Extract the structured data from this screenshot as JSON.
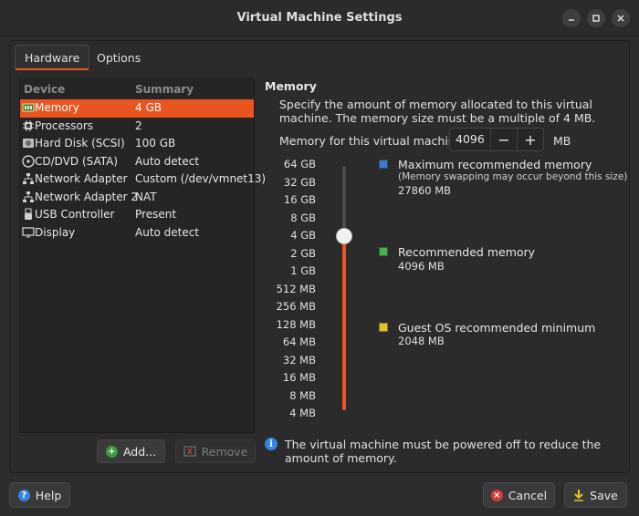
{
  "window": {
    "title": "Virtual Machine Settings"
  },
  "tabs": [
    {
      "label": "Hardware",
      "active": true
    },
    {
      "label": "Options",
      "active": false
    }
  ],
  "device_list": {
    "columns": [
      "Device",
      "Summary"
    ],
    "items": [
      {
        "name": "Memory",
        "summary": "4 GB",
        "icon": "memory-icon",
        "selected": true
      },
      {
        "name": "Processors",
        "summary": "2",
        "icon": "processor-icon"
      },
      {
        "name": "Hard Disk (SCSI)",
        "summary": "100 GB",
        "icon": "hard-disk-icon"
      },
      {
        "name": "CD/DVD (SATA)",
        "summary": "Auto detect",
        "icon": "cd-dvd-icon"
      },
      {
        "name": "Network Adapter",
        "summary": "Custom (/dev/vmnet13)",
        "icon": "network-icon"
      },
      {
        "name": "Network Adapter 2",
        "summary": "NAT",
        "icon": "network-icon"
      },
      {
        "name": "USB Controller",
        "summary": "Present",
        "icon": "usb-icon"
      },
      {
        "name": "Display",
        "summary": "Auto detect",
        "icon": "display-icon"
      }
    ],
    "add_label": "Add...",
    "remove_label": "Remove"
  },
  "memory": {
    "title": "Memory",
    "description": "Specify the amount of memory allocated to this virtual machine. The memory size must be a multiple of 4 MB.",
    "field_label": "Memory for this virtual machine:",
    "value": "4096",
    "unit": "MB",
    "decrement": "−",
    "increment": "+",
    "scale": [
      "64 GB",
      "32 GB",
      "16 GB",
      "8 GB",
      "4 GB",
      "2 GB",
      "1 GB",
      "512 MB",
      "256 MB",
      "128 MB",
      "64 MB",
      "32 MB",
      "16 MB",
      "8 MB",
      "4 MB"
    ],
    "slider_level": 0.286,
    "legend": {
      "max": {
        "title": "Maximum recommended memory",
        "note": "(Memory swapping may occur beyond this size)",
        "value": "27860 MB",
        "color": "#3d7cc9"
      },
      "recommended": {
        "title": "Recommended memory",
        "value": "4096 MB",
        "color": "#4caf50"
      },
      "guest_min": {
        "title": "Guest OS recommended minimum",
        "value": "2048 MB",
        "color": "#e6c229"
      }
    },
    "info": "The virtual machine must be powered off to reduce the amount of memory."
  },
  "footer": {
    "help_label": "Help",
    "cancel_label": "Cancel",
    "save_label": "Save"
  },
  "colors": {
    "accent": "#e95420",
    "background": "#2d2d2d"
  }
}
